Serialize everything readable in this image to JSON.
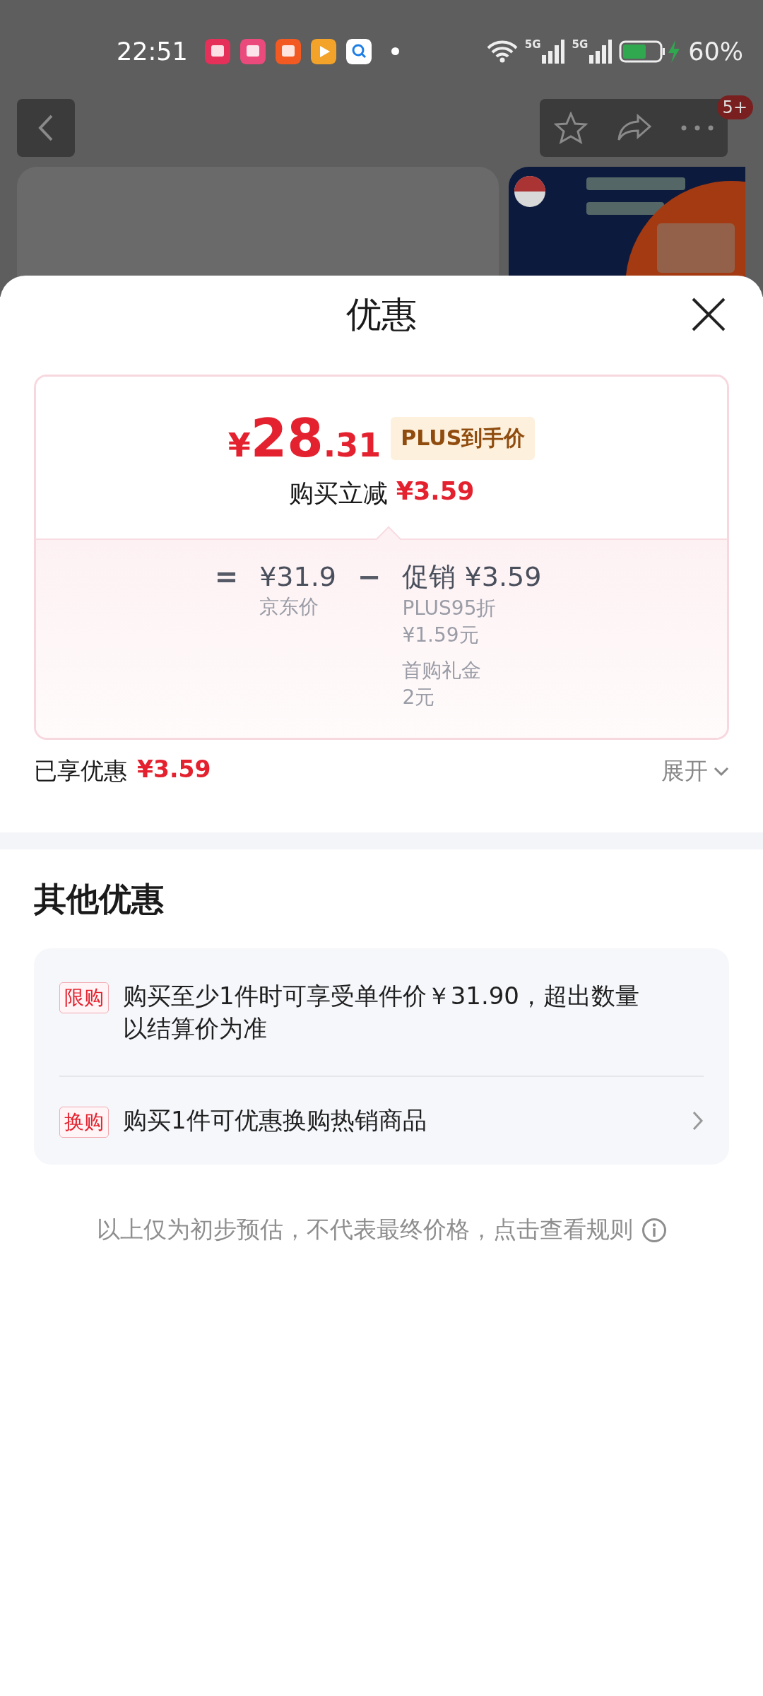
{
  "status_bar": {
    "time": "22:51",
    "network_labels": [
      "5G",
      "5G"
    ],
    "battery": "60%"
  },
  "nav": {
    "badge": "5+"
  },
  "sheet": {
    "title": "优惠",
    "price_card": {
      "currency": "¥",
      "integer": "28",
      "decimal": ".31",
      "price_tag": "PLUS到手价",
      "instant_discount": {
        "label": "购买立减",
        "amount": "¥3.59"
      },
      "breakdown": {
        "equals": "=",
        "base": {
          "amount": "¥31.9",
          "label": "京东价"
        },
        "minus": "−",
        "promo": {
          "title": "促销 ¥3.59",
          "items": [
            {
              "name": "PLUS95折",
              "value": "¥1.59元"
            },
            {
              "name": "首购礼金",
              "value": "2元"
            }
          ]
        }
      }
    },
    "enjoyed": {
      "label": "已享优惠",
      "amount": "¥3.59",
      "expand": "展开"
    },
    "other": {
      "title": "其他优惠",
      "offers": [
        {
          "kind": "info",
          "tag": "限购",
          "text": "购买至少1件时可享受单件价￥31.90，超出数量以结算价为准"
        },
        {
          "kind": "link",
          "tag": "换购",
          "text": "购买1件可优惠换购热销商品"
        }
      ]
    },
    "footer": "以上仅为初步预估，不代表最终价格，点击查看规则"
  }
}
